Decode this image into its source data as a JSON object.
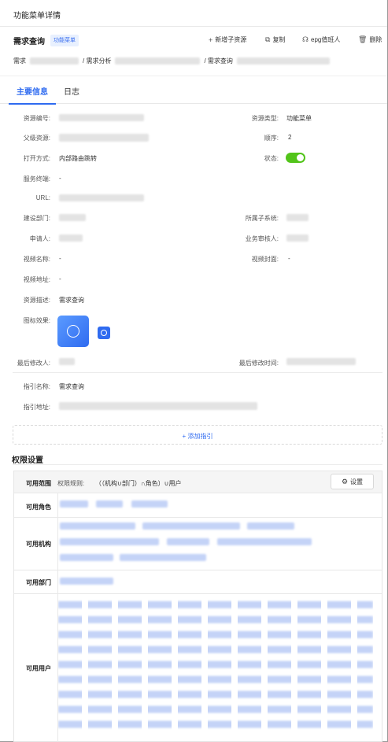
{
  "window": {
    "title": "功能菜单详情"
  },
  "header": {
    "name": "需求查询",
    "tag": "功能菜单",
    "actions": [
      {
        "icon": "plus-icon",
        "label": "新增子资源"
      },
      {
        "icon": "copy-icon",
        "label": "复制"
      },
      {
        "icon": "headset-icon",
        "label": "epg值班人"
      },
      {
        "icon": "trash-icon",
        "label": "删除"
      }
    ]
  },
  "breadcrumb": {
    "item1": "需求",
    "item2": "/ 需求分析",
    "item3": "/ 需求查询"
  },
  "tabs": {
    "main": "主要信息",
    "log": "日志"
  },
  "fields": {
    "resource_code_label": "资源编号:",
    "resource_type_label": "资源类型:",
    "resource_type_value": "功能菜单",
    "parent_label": "父级资源:",
    "order_label": "顺序:",
    "order_value": "2",
    "open_mode_label": "打开方式:",
    "open_mode_value": "内部路由跳转",
    "status_label": "状态:",
    "service_label": "服务终端:",
    "service_value": "-",
    "url_label": "URL:",
    "dept_label": "建设部门:",
    "subsystem_label": "所属子系统:",
    "applicant_label": "申请人:",
    "reviewer_label": "业务审核人:",
    "video_name_label": "视频名称:",
    "video_name_value": "-",
    "video_cover_label": "视频封面:",
    "video_cover_value": "-",
    "video_url_label": "视频地址:",
    "video_url_value": "-",
    "desc_label": "资源描述:",
    "desc_value": "需求查询",
    "icon_label": "图标效果:",
    "last_modifier_label": "最后修改人:",
    "last_modified_label": "最后修改时间:",
    "guide_name_label": "指引名称:",
    "guide_name_value": "需求查询",
    "guide_url_label": "指引地址:",
    "add_guide": "+ 添加指引"
  },
  "permissions": {
    "title": "权限设置",
    "scope_label": "可用范围",
    "rule_label": "权限规则:",
    "rule_value": "（（机构∪部门）∩角色）∪用户",
    "settings_button": "设置",
    "roles_label": "可用角色",
    "orgs_label": "可用机构",
    "depts_label": "可用部门",
    "users_label": "可用用户"
  },
  "colors": {
    "accent": "#2f6bf0",
    "toggle_on": "#52c41a",
    "tag_bg": "#e8f0fe"
  }
}
